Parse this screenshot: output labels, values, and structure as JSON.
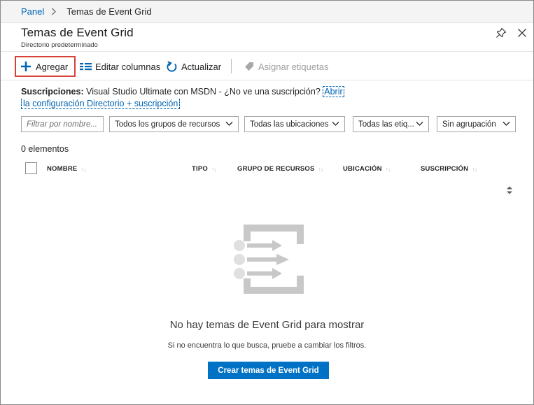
{
  "breadcrumb": {
    "home": "Panel",
    "current": "Temas de Event Grid"
  },
  "header": {
    "title": "Temas de Event Grid",
    "subtitle": "Directorio predeterminado"
  },
  "toolbar": {
    "add_label": "Agregar",
    "edit_columns_label": "Editar columnas",
    "refresh_label": "Actualizar",
    "assign_tags_label": "Asignar etiquetas"
  },
  "subscriptions": {
    "label": "Suscripciones:",
    "value": "Visual Studio Ultimate con MSDN",
    "question": "- ¿No ve una suscripción?",
    "link_part1": "Abrir",
    "link_part2": "la configuración Directorio + suscripción"
  },
  "filters": {
    "name_placeholder": "Filtrar por nombre...",
    "resource_groups": "Todos los grupos de recursos",
    "locations": "Todas las ubicaciones",
    "tags": "Todas las etiq...",
    "grouping": "Sin agrupación"
  },
  "list": {
    "count": "0 elementos",
    "columns": [
      "NOMBRE",
      "TIPO",
      "GRUPO DE RECURSOS",
      "UBICACIÓN",
      "SUSCRIPCIÓN"
    ]
  },
  "empty_state": {
    "title": "No hay temas de Event Grid para mostrar",
    "hint": "Si no encuentra lo que busca, pruebe a cambiar los filtros.",
    "button": "Crear temas de Event Grid"
  },
  "colors": {
    "link": "#0063b1",
    "primary_button": "#0072c6",
    "highlight_border": "#d8413a",
    "illustration": "#c8c8c8"
  }
}
